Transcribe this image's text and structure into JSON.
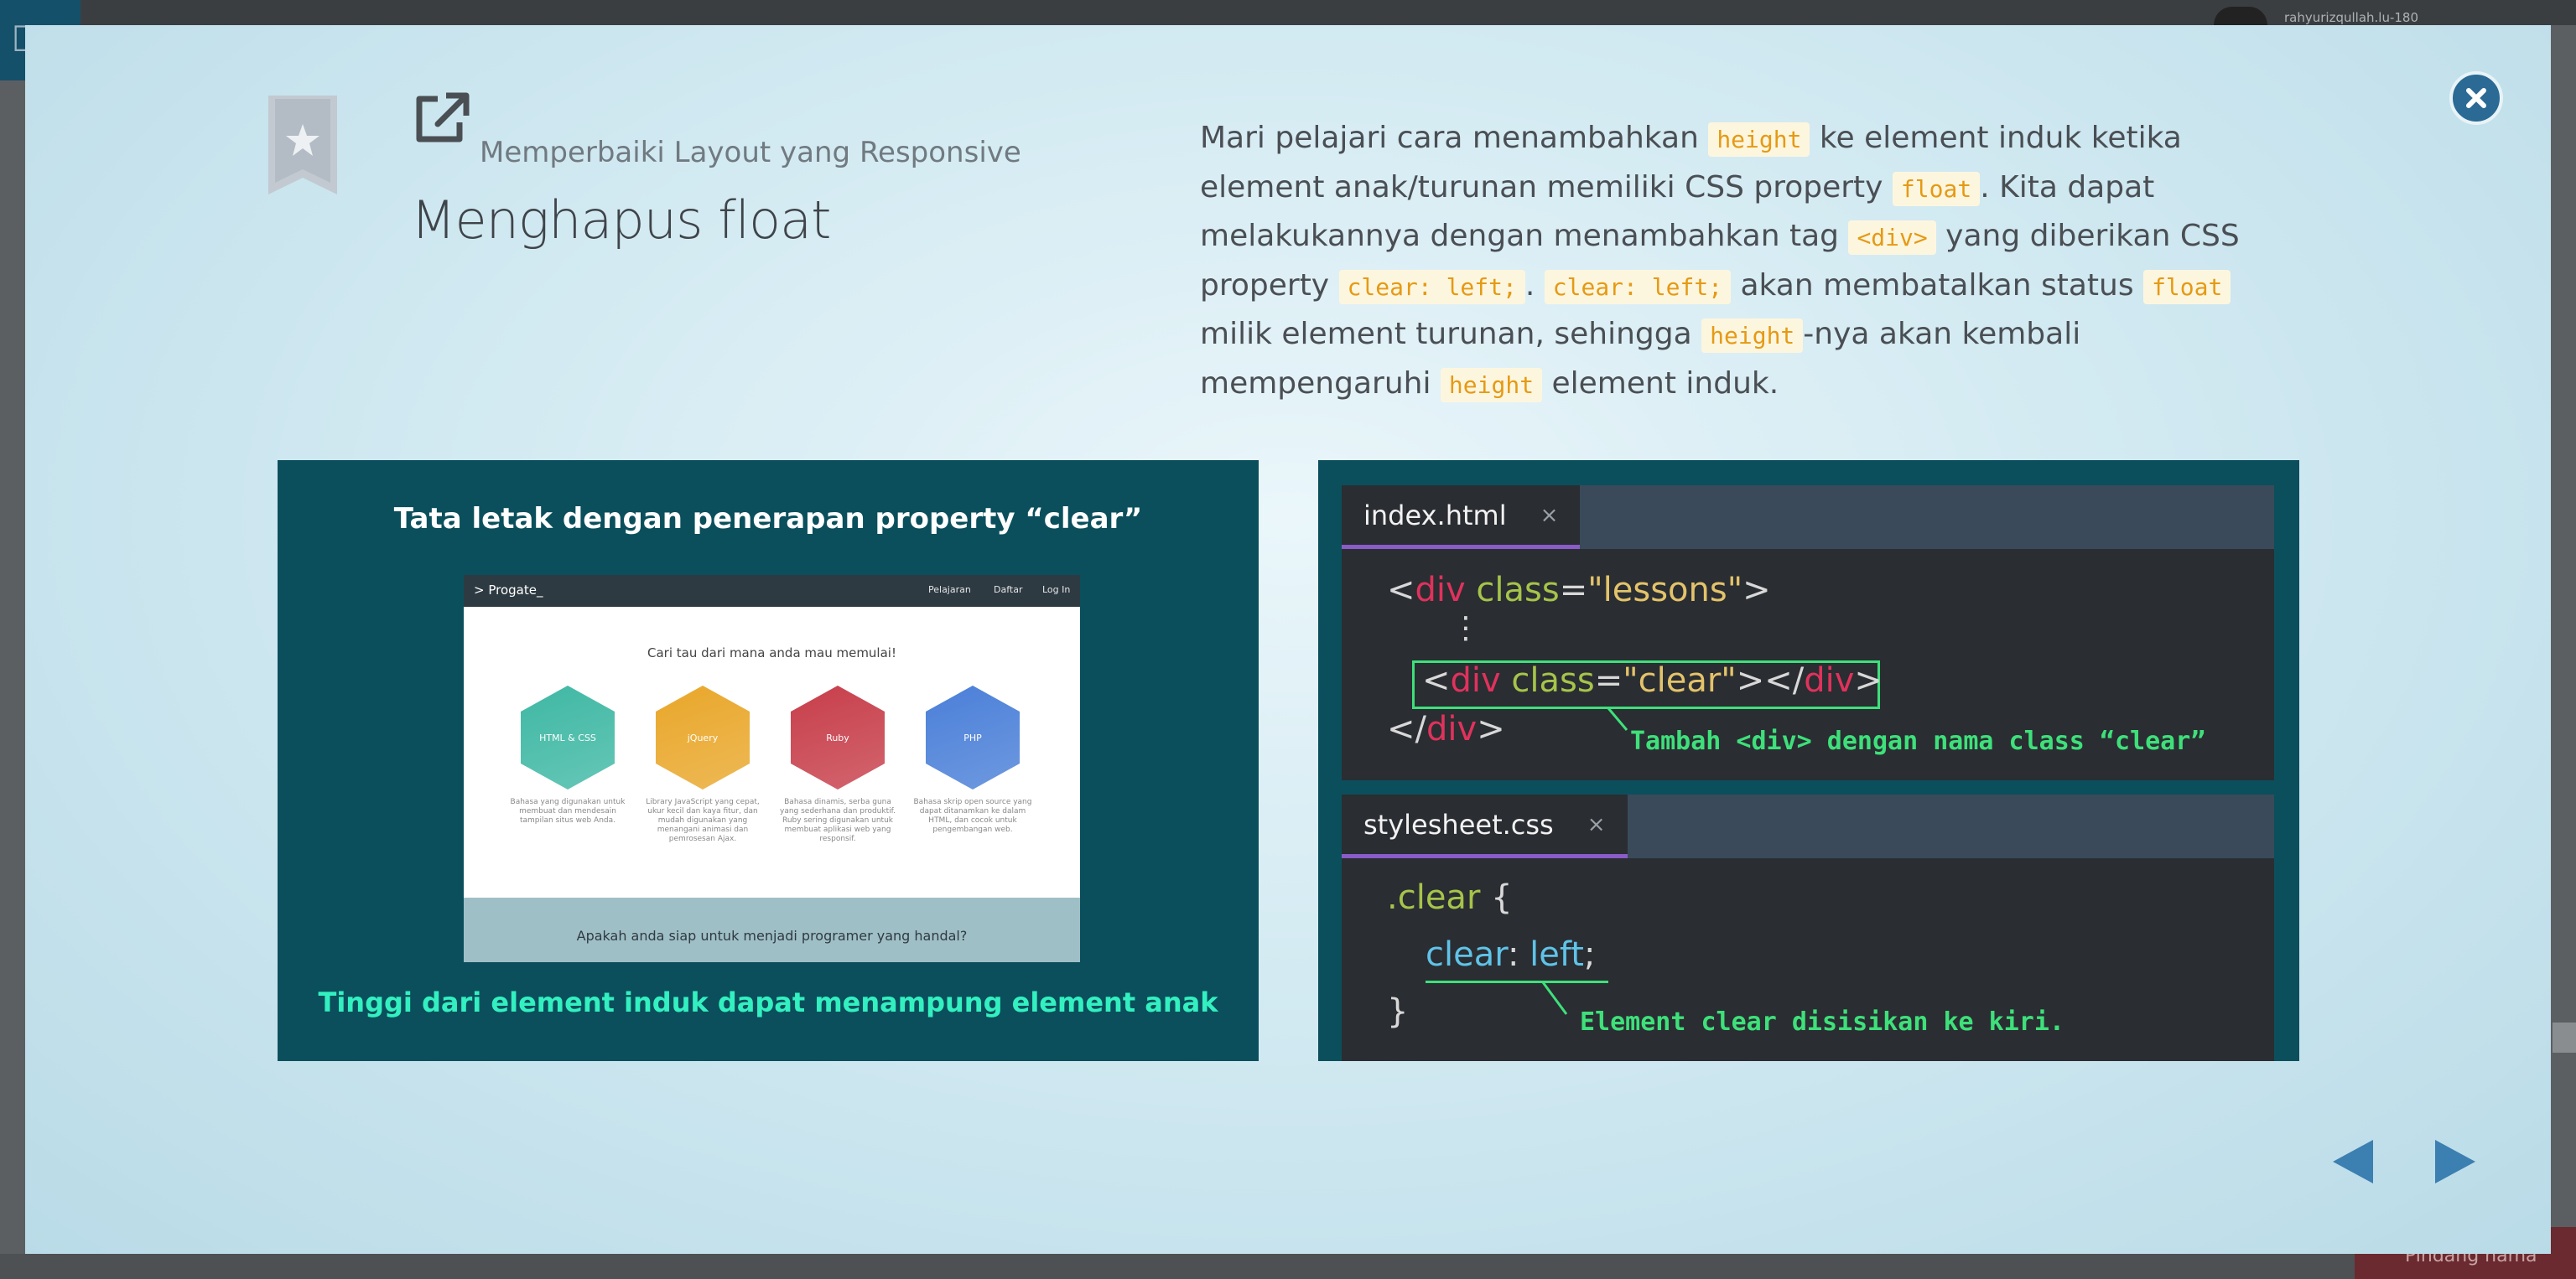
{
  "background": {
    "username": "rahyurizqullah.lu-180",
    "bottom_button": "Pindang nama"
  },
  "modal": {
    "close_icon": "close-icon",
    "bookmark_icon": "bookmark-star-icon",
    "link_icon": "external-link-icon",
    "subtitle": "Memperbaiki Layout yang Responsive",
    "title": "Menghapus float",
    "description": {
      "seg1": "Mari pelajari cara menambahkan ",
      "code1": "height",
      "seg2": " ke element induk ketika element anak/turunan memiliki CSS property ",
      "code2": "float",
      "seg3": ". Kita dapat melakukannya dengan menambahkan tag ",
      "code3": "<div>",
      "seg4": " yang diberikan CSS property ",
      "code4": "clear: left;",
      "seg5": ". ",
      "code5": "clear: left;",
      "seg6": " akan membatalkan status ",
      "code6": "float",
      "seg7": " milik element turunan, sehingga ",
      "code7": "height",
      "seg8": "-nya akan kembali mempengaruhi ",
      "code8": "height",
      "seg9": " element induk."
    },
    "prev_icon": "chevron-left-icon",
    "next_icon": "chevron-right-icon"
  },
  "slide_left": {
    "title": "Tata letak dengan penerapan property “clear”",
    "caption": "Tinggi dari element induk dapat menampung element anak",
    "browser": {
      "logo": "> Progate_",
      "nav": [
        "Pelajaran",
        "Daftar",
        "Log In"
      ],
      "heading": "Cari tau dari mana anda mau memulai!",
      "hexes": [
        {
          "label": "HTML & CSS",
          "desc": "Bahasa yang digunakan untuk membuat dan mendesain tampilan situs web Anda.",
          "color": "#3fb8a4"
        },
        {
          "label": "jQuery",
          "desc": "Library JavaScript yang cepat, ukur kecil dan kaya fitur, dan mudah digunakan yang menangani animasi dan pemrosesan Ajax.",
          "color": "#e9a72a"
        },
        {
          "label": "Ruby",
          "desc": "Bahasa dinamis, serba guna yang sederhana dan produktif. Ruby sering digunakan untuk membuat aplikasi web yang responsif.",
          "color": "#c73e4a"
        },
        {
          "label": "PHP",
          "desc": "Bahasa skrip open source yang dapat ditanamkan ke dalam HTML, dan cocok untuk pengembangan web.",
          "color": "#4a7fd8"
        }
      ],
      "footer": "Apakah anda siap untuk menjadi programer yang handal?"
    }
  },
  "slide_right": {
    "html_tab": "index.html",
    "html_tab_close": "×",
    "html_lines": {
      "l1_open": "<",
      "l1_tag": "div",
      "l1_attr": " class",
      "l1_eq": "=",
      "l1_str": "\"lessons\"",
      "l1_close": ">",
      "dots": "⋮",
      "l3_open": "<",
      "l3_tag": "div",
      "l3_attr": " class",
      "l3_eq": "=",
      "l3_str": "\"clear\"",
      "l3_mid": "></",
      "l3_tag2": "div",
      "l3_close": ">",
      "l4_open": "</",
      "l4_tag": "div",
      "l4_close": ">"
    },
    "html_annotation": "Tambah <div> dengan nama class “clear”",
    "css_tab": "stylesheet.css",
    "css_tab_close": "×",
    "css_lines": {
      "selector": ".clear",
      "brace_open": " {",
      "prop": "clear",
      "colon": ": ",
      "value": "left",
      "semi": ";",
      "brace_close": "}"
    },
    "css_annotation": "Element clear disisikan ke kiri."
  }
}
